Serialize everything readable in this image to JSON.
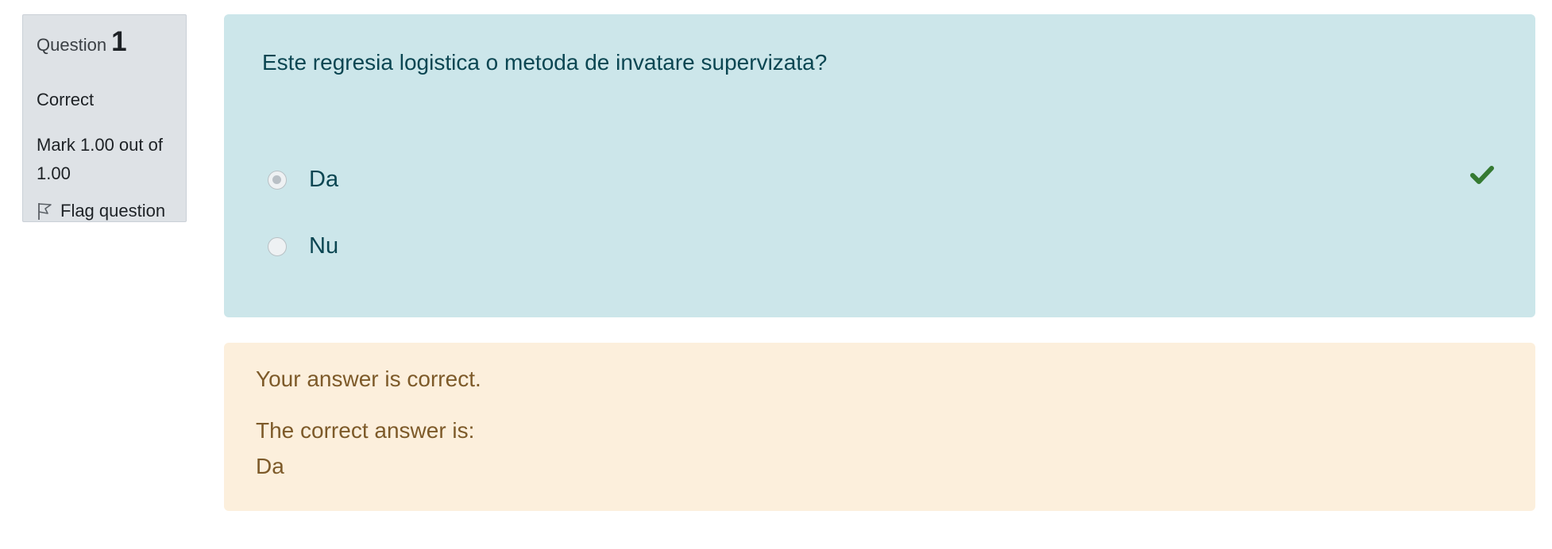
{
  "info": {
    "question_label": "Question",
    "question_number": "1",
    "state": "Correct",
    "grade": "Mark 1.00 out of 1.00",
    "flag_label": "Flag question"
  },
  "question": {
    "text": "Este regresia logistica o metoda de invatare supervizata?",
    "options": [
      {
        "label": "Da",
        "selected": true,
        "correct": true
      },
      {
        "label": "Nu",
        "selected": false,
        "correct": false
      }
    ]
  },
  "outcome": {
    "feedback": "Your answer is correct.",
    "right_answer_label": "The correct answer is:",
    "right_answer_value": "Da"
  },
  "colors": {
    "info_bg": "#dee2e6",
    "formulation_bg": "#cce6ea",
    "formulation_text": "#0b4652",
    "outcome_bg": "#fcefdc",
    "outcome_text": "#7d5a29",
    "check_color": "#357a32"
  },
  "icons": {
    "flag": "flag-icon",
    "correct": "check-icon"
  }
}
